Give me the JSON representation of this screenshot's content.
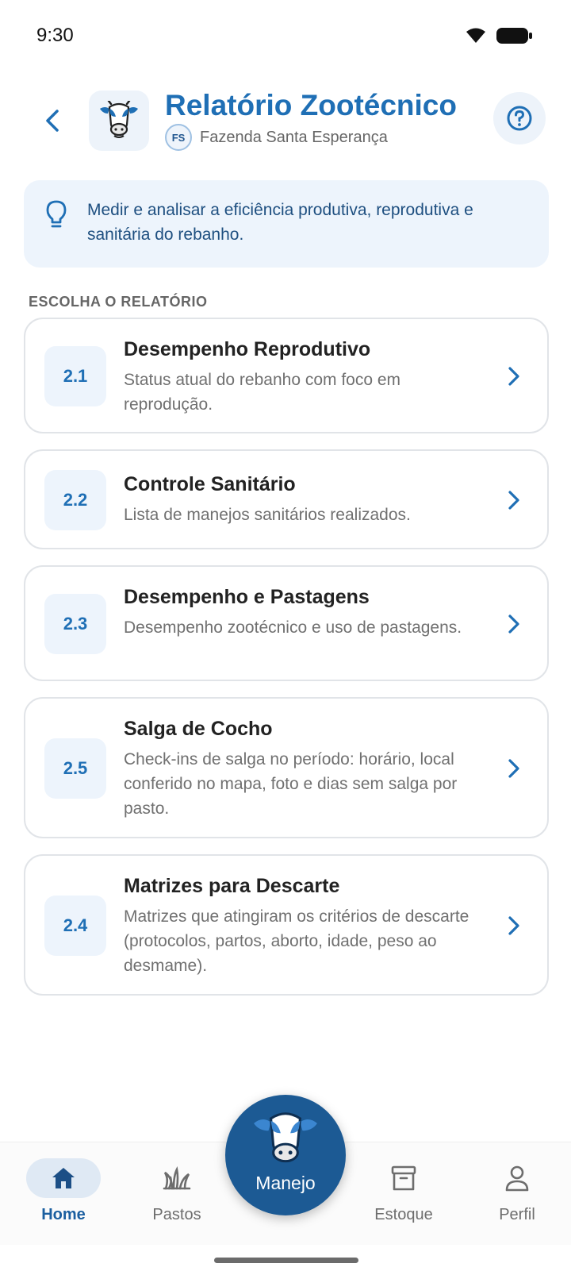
{
  "status_bar": {
    "time": "9:30"
  },
  "header": {
    "title": "Relatório Zootécnico",
    "farm_initials": "FS",
    "farm_name": "Fazenda Santa Esperança"
  },
  "info": {
    "text": "Medir e analisar a eficiência produtiva, reprodutiva e sanitária do rebanho."
  },
  "section_label": "ESCOLHA O RELATÓRIO",
  "reports": [
    {
      "code": "2.1",
      "title": "Desempenho Reprodutivo",
      "description": "Status atual do rebanho com foco em reprodução."
    },
    {
      "code": "2.2",
      "title": "Controle Sanitário",
      "description": "Lista de manejos sanitários realizados."
    },
    {
      "code": "2.3",
      "title": "Desempenho e Pastagens",
      "description": "Desempenho zootécnico e uso de pastagens."
    },
    {
      "code": "2.5",
      "title": "Salga de Cocho",
      "description": "Check-ins de salga no período: horário, local conferido no mapa, foto e dias sem salga por pasto."
    },
    {
      "code": "2.4",
      "title": "Matrizes para Descarte",
      "description": "Matrizes que atingiram os critérios de descarte (protocolos, partos, aborto, idade, peso ao desmame)."
    }
  ],
  "nav": {
    "items": [
      {
        "label": "Home",
        "icon": "home-icon",
        "active": true
      },
      {
        "label": "Pastos",
        "icon": "grass-icon",
        "active": false
      },
      {
        "label": "Estoque",
        "icon": "archive-box-icon",
        "active": false
      },
      {
        "label": "Perfil",
        "icon": "person-icon",
        "active": false
      }
    ],
    "fab_label": "Manejo"
  },
  "colors": {
    "primary": "#1f6fb5",
    "primary_dark": "#1c5a94",
    "info_bg": "#edf4fc",
    "info_text": "#1e4f80",
    "card_border": "#e1e4e8"
  }
}
